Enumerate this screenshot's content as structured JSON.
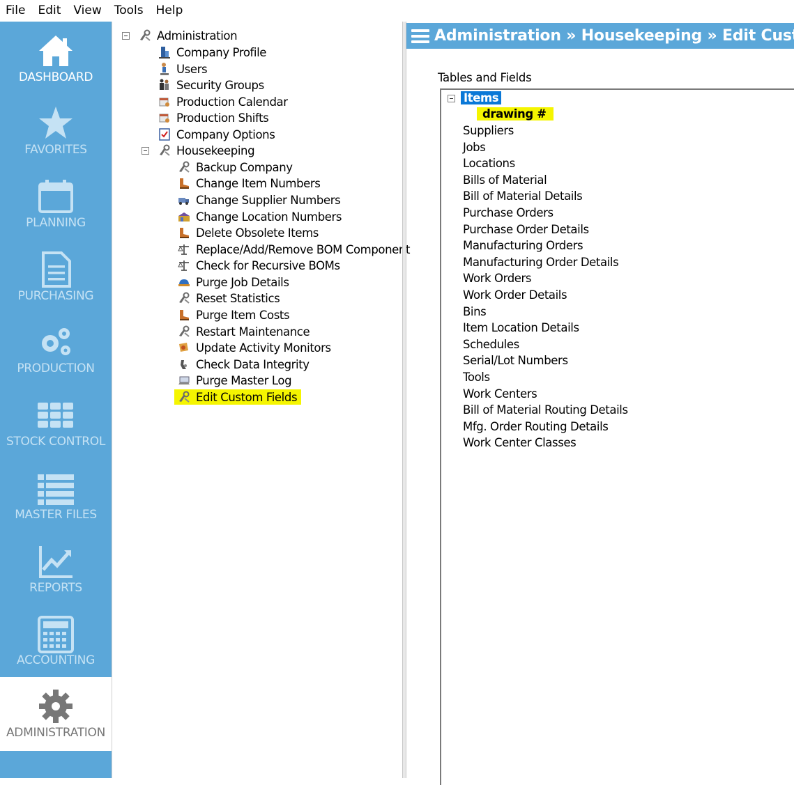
{
  "menu": [
    "File",
    "Edit",
    "View",
    "Tools",
    "Help"
  ],
  "nav": {
    "items": [
      {
        "label": "DASHBOARD",
        "icon": "home-icon"
      },
      {
        "label": "FAVORITES",
        "icon": "star-icon"
      },
      {
        "label": "PLANNING",
        "icon": "calendar-icon"
      },
      {
        "label": "PURCHASING",
        "icon": "document-icon"
      },
      {
        "label": "PRODUCTION",
        "icon": "gears-icon"
      },
      {
        "label": "STOCK CONTROL",
        "icon": "grid-icon"
      },
      {
        "label": "MASTER FILES",
        "icon": "list-icon"
      },
      {
        "label": "REPORTS",
        "icon": "chart-icon"
      },
      {
        "label": "ACCOUNTING",
        "icon": "calculator-icon"
      },
      {
        "label": "ADMINISTRATION",
        "icon": "gear-icon"
      }
    ],
    "active": "ADMINISTRATION"
  },
  "tree": {
    "root": "Administration",
    "children": [
      "Company Profile",
      "Users",
      "Security Groups",
      "Production Calendar",
      "Production Shifts",
      "Company Options"
    ],
    "housekeeping": {
      "label": "Housekeeping",
      "children": [
        "Backup Company",
        "Change Item Numbers",
        "Change Supplier Numbers",
        "Change Location Numbers",
        "Delete Obsolete Items",
        "Replace/Add/Remove BOM Component",
        "Check for Recursive BOMs",
        "Purge Job Details",
        "Reset Statistics",
        "Purge Item Costs",
        "Restart Maintenance",
        "Update Activity Monitors",
        "Check Data Integrity",
        "Purge Master Log",
        "Edit Custom Fields"
      ]
    },
    "selected": "Edit Custom Fields"
  },
  "header": {
    "title": "Administration » Housekeeping » Edit Custom Fie"
  },
  "fields_panel": {
    "label": "Tables and Fields",
    "root": "Items",
    "root_field": "drawing #",
    "tables": [
      "Suppliers",
      "Jobs",
      "Locations",
      "Bills of Material",
      "Bill of Material Details",
      "Purchase Orders",
      "Purchase Order Details",
      "Manufacturing Orders",
      "Manufacturing Order Details",
      "Work Orders",
      "Work Order Details",
      "Bins",
      "Item Location Details",
      "Schedules",
      "Serial/Lot Numbers",
      "Tools",
      "Work Centers",
      "Bill of Material Routing Details",
      "Mfg. Order Routing Details",
      "Work Center Classes"
    ]
  },
  "colors": {
    "nav_bg": "#5ba7d9",
    "highlight": "#f5f500",
    "selection": "#0a78d7"
  }
}
